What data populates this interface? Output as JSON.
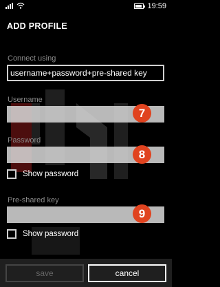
{
  "status": {
    "time": "19:59"
  },
  "page": {
    "title": "ADD PROFILE"
  },
  "connect_using": {
    "label": "Connect using",
    "value": "username+password+pre-shared key"
  },
  "username": {
    "label": "Username",
    "value": ""
  },
  "password": {
    "label": "Password",
    "value": ""
  },
  "show_password_1": {
    "label": "Show password",
    "checked": false
  },
  "preshared_key": {
    "label": "Pre-shared key",
    "value": ""
  },
  "show_password_2": {
    "label": "Show password",
    "checked": false
  },
  "badges": {
    "username": "7",
    "password": "8",
    "preshared": "9"
  },
  "appbar": {
    "save_label": "save",
    "cancel_label": "cancel"
  },
  "colors": {
    "badge": "#e0431f",
    "background": "#000000"
  }
}
